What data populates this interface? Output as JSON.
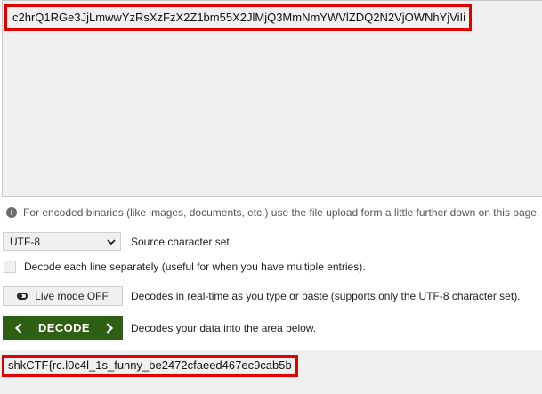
{
  "input": {
    "value": "c2hrQ1RGe3JjLmwwYzRsXzFzX2Z1bm55X2JlMjQ3MmNmYWVlZDQ2N2VjOWNhYjViIi"
  },
  "info_note": {
    "text": "For encoded binaries (like images, documents, etc.) use the file upload form a little further down on this page."
  },
  "charset": {
    "selected": "UTF-8",
    "label": "Source character set."
  },
  "decode_each_line": {
    "label": "Decode each line separately (useful for when you have multiple entries).",
    "checked": false
  },
  "live_mode": {
    "button_label": "Live mode OFF",
    "description": "Decodes in real-time as you type or paste (supports only the UTF-8 character set)."
  },
  "decode": {
    "button_label": "DECODE",
    "description": "Decodes your data into the area below."
  },
  "output": {
    "value": "shkCTF{rc.l0c4l_1s_funny_be2472cfaeed467ec9cab5b"
  },
  "colors": {
    "highlight_border": "#e00000",
    "decode_button": "#2f5f12",
    "field_background": "#f0f0f0"
  }
}
